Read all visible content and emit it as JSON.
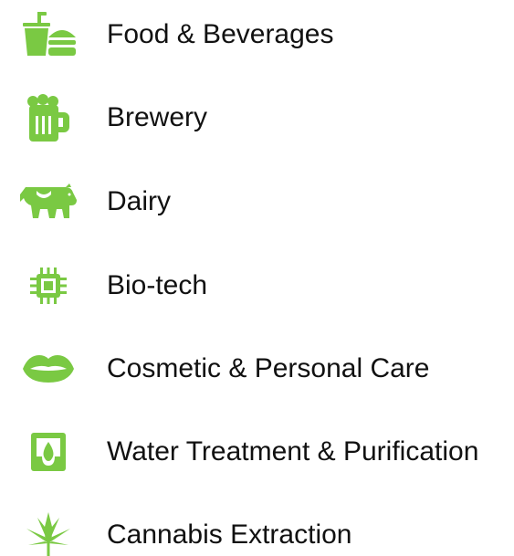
{
  "theme": {
    "icon_color": "#7ac943",
    "text_color": "#111111"
  },
  "industries": [
    {
      "label": "Food & Beverages",
      "icon": "food-beverage-icon"
    },
    {
      "label": "Brewery",
      "icon": "beer-mug-icon"
    },
    {
      "label": "Dairy",
      "icon": "cow-icon"
    },
    {
      "label": "Bio-tech",
      "icon": "microchip-icon"
    },
    {
      "label": "Cosmetic & Personal Care",
      "icon": "lips-icon"
    },
    {
      "label": "Water Treatment & Purification",
      "icon": "water-drop-box-icon"
    },
    {
      "label": "Cannabis Extraction",
      "icon": "cannabis-leaf-icon"
    }
  ]
}
